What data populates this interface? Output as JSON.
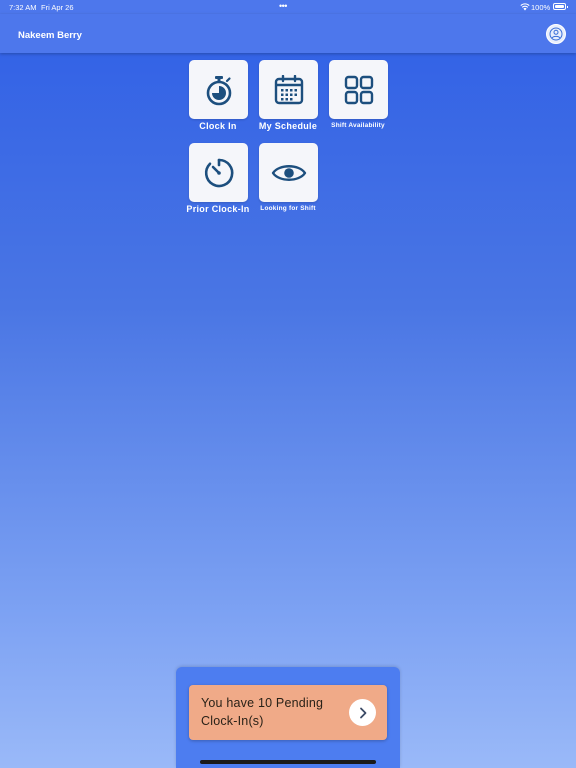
{
  "status_bar": {
    "time": "7:32 AM",
    "date": "Fri Apr 26",
    "battery": "100%",
    "battery_level": 1.0
  },
  "header": {
    "user_name": "Nakeem Berry",
    "profile_icon": "person-circle-icon"
  },
  "tiles": [
    {
      "label": "Clock In",
      "icon": "stopwatch-icon"
    },
    {
      "label": "My Schedule",
      "icon": "calendar-icon"
    },
    {
      "label": "Shift Availability",
      "icon": "grid-icon"
    },
    {
      "label": "Prior Clock-In",
      "icon": "timer-icon"
    },
    {
      "label": "Looking for Shift",
      "icon": "eye-icon"
    }
  ],
  "pending": {
    "message": "You have 10 Pending Clock-In(s)",
    "action_icon": "chevron-right-icon"
  },
  "colors": {
    "header": "#4d77ec",
    "background_top": "#2f5fe6",
    "background_bottom": "#9ab9f8",
    "tile_icon": "#1d4f7e",
    "pending_card": "#f0aa88"
  }
}
